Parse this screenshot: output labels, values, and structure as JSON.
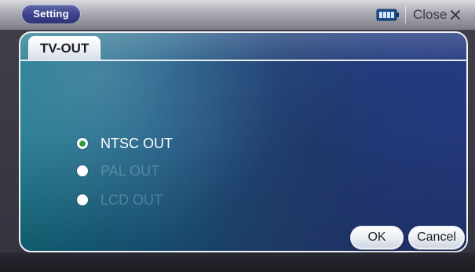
{
  "header": {
    "setting_label": "Setting",
    "close_label": "Close",
    "icons": {
      "battery": "battery-icon",
      "close": "close-icon"
    }
  },
  "tabs": [
    {
      "label": "TV-OUT",
      "selected": true
    }
  ],
  "options": [
    {
      "label": "NTSC OUT",
      "selected": true,
      "enabled": true
    },
    {
      "label": "PAL OUT",
      "selected": false,
      "enabled": false
    },
    {
      "label": "LCD OUT",
      "selected": false,
      "enabled": false
    }
  ],
  "actions": {
    "ok_label": "OK",
    "cancel_label": "Cancel"
  },
  "colors": {
    "accent_green": "#2d9a3a",
    "header_pill": "#3b418d",
    "panel_blue": "#253a7f"
  }
}
